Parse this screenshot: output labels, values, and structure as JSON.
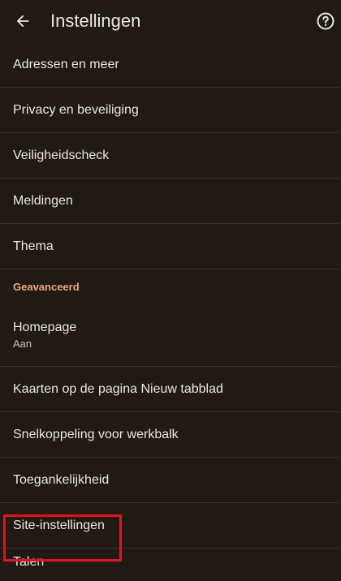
{
  "header": {
    "title": "Instellingen",
    "back_icon": "arrow-back-icon",
    "help_icon": "help-circle-icon"
  },
  "items": [
    {
      "label": "Adressen en meer"
    },
    {
      "label": "Privacy en beveiliging"
    },
    {
      "label": "Veiligheidscheck"
    },
    {
      "label": "Meldingen"
    },
    {
      "label": "Thema"
    }
  ],
  "section": {
    "label": "Geavanceerd",
    "color": "#f2a77a"
  },
  "advanced_items": [
    {
      "label": "Homepage",
      "sub": "Aan"
    },
    {
      "label": "Kaarten op de pagina Nieuw tabblad"
    },
    {
      "label": "Snelkoppeling voor werkbalk"
    },
    {
      "label": "Toegankelijkheid"
    },
    {
      "label": "Site-instellingen"
    },
    {
      "label": "Talen"
    }
  ],
  "colors": {
    "background": "#1f1a16",
    "text": "#ece6e0",
    "divider": "#3a332e",
    "highlight": "#e0141e"
  }
}
